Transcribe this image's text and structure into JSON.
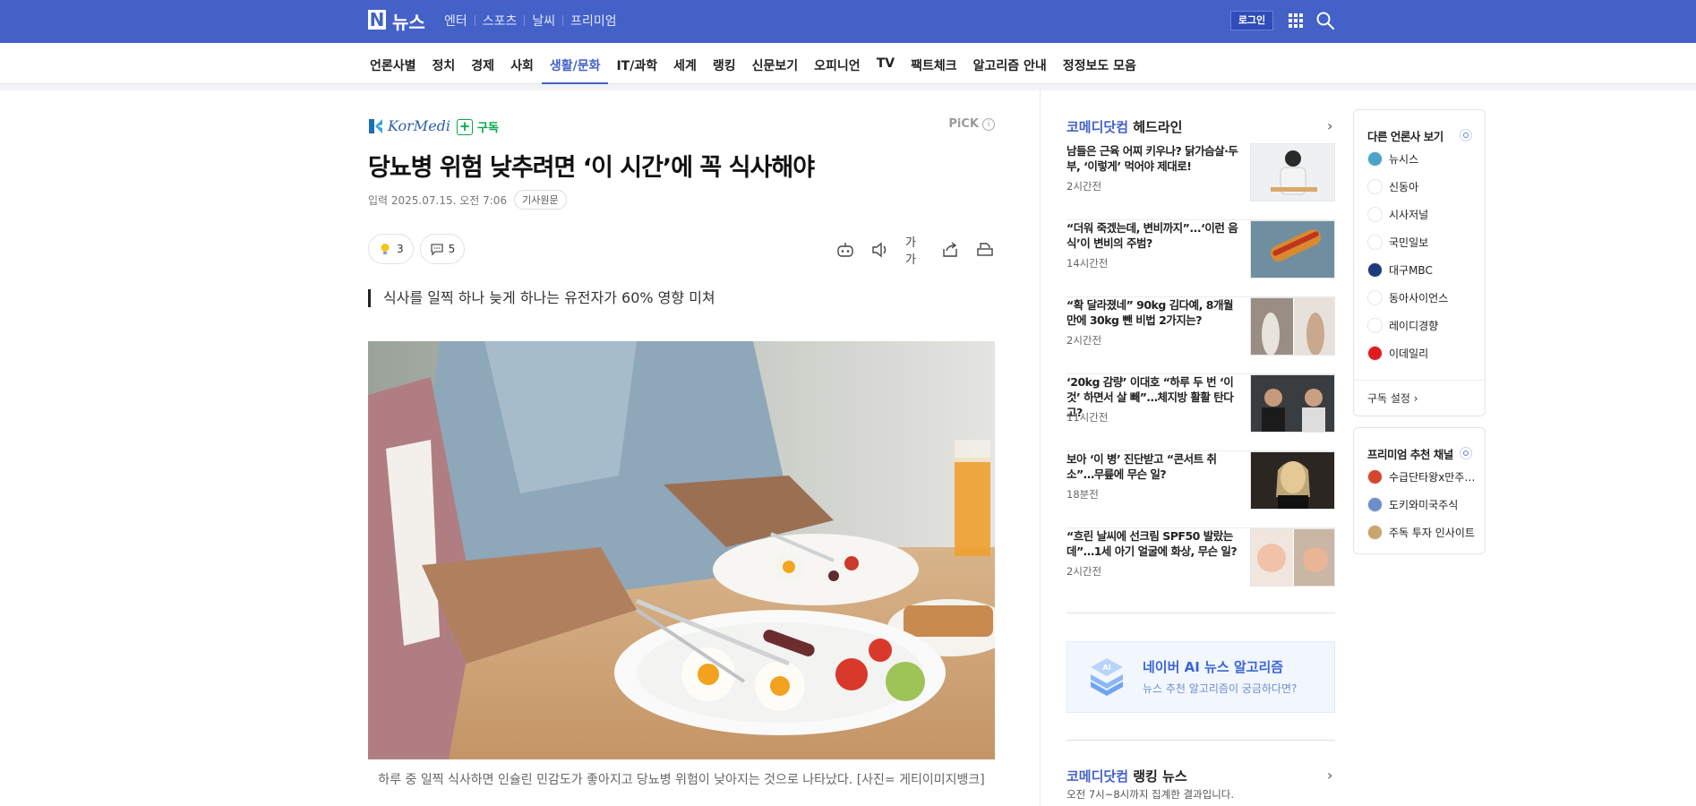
{
  "topbar": {
    "logo_letter": "N",
    "brand": "뉴스",
    "nav": [
      "엔터",
      "스포츠",
      "날씨",
      "프리미엄"
    ],
    "login_label": "로그인"
  },
  "category_nav": {
    "items": [
      "언론사별",
      "정치",
      "경제",
      "사회",
      "생활/문화",
      "IT/과학",
      "세계",
      "랭킹",
      "신문보기",
      "오피니언",
      "TV",
      "팩트체크",
      "알고리즘 안내",
      "정정보도 모음"
    ],
    "active": "생활/문화"
  },
  "article": {
    "press_name": "KorMedi",
    "subscribe_label": "구독",
    "pick_label": "PiCK",
    "pick_info": "i",
    "headline": "당뇨병 위험 낮추려면 ‘이 시간’에 꼭 식사해야",
    "meta": {
      "date": "입력 2025.07.15. 오전 7:06",
      "original_label": "기사원문"
    },
    "reactions": {
      "likes": "3",
      "comments": "5"
    },
    "text_size_label": "가가",
    "summary": "식사를 일찍 하나 늦게 하나는 유전자가 60% 영향 미쳐",
    "caption": "하루 중 일찍 식사하면 인슐린 민감도가 좋아지고 당뇨병 위험이 낮아지는 것으로 나타났다. [사진= 게티이미지뱅크]"
  },
  "headlines": {
    "press": "코메디닷컴",
    "title_suffix": " 헤드라인",
    "items": [
      {
        "title": "남들은 근육 어찌 키우나? 닭가슴살·두부, ‘이렇게’ 먹어야 제대로!",
        "ago": "2시간전"
      },
      {
        "title": "“더워 죽겠는데, 변비까지”...‘이런 음식’이 변비의 주범?",
        "ago": "14시간전"
      },
      {
        "title": "“확 달라졌네” 90kg 김다예, 8개월 만에 30kg 뺀 비법 2가지는?",
        "ago": "2시간전"
      },
      {
        "title": "‘20kg 감량’ 이대호 “하루 두 번 ‘이것’ 하면서 살 빼”…체지방 활활 탄다고?",
        "ago": "11시간전"
      },
      {
        "title": "보아 ‘이 병’ 진단받고 “콘서트 취소”…무릎에 무슨 일?",
        "ago": "18분전"
      },
      {
        "title": "“흐린 날씨에 선크림 SPF50 발랐는데”…1세 아기 얼굴에 화상, 무슨 일?",
        "ago": "2시간전"
      }
    ],
    "ai_box": {
      "title": "네이버 AI 뉴스 알고리즘",
      "subtitle": "뉴스 추천 알고리즘이 궁금하다면?",
      "icon_text": "AI"
    },
    "ranking": {
      "press": "코메디닷컴",
      "title_suffix": " 랭킹 뉴스",
      "subtitle": "오전 7시~8시까지 집계한 결과입니다."
    }
  },
  "other_press": {
    "title": "다른 언론사 보기",
    "items": [
      {
        "name": "뉴시스",
        "color": "#4aa3c9"
      },
      {
        "name": "신동아",
        "color": "#ffffff"
      },
      {
        "name": "시사저널",
        "color": "#ffffff"
      },
      {
        "name": "국민일보",
        "color": "#ffffff"
      },
      {
        "name": "대구MBC",
        "color": "#1f3a7a"
      },
      {
        "name": "동아사이언스",
        "color": "#ffffff"
      },
      {
        "name": "레이디경향",
        "color": "#ffffff"
      },
      {
        "name": "이데일리",
        "color": "#e11a1f"
      }
    ],
    "footer": "구독 설정"
  },
  "premium": {
    "title": "프리미엄 추천 채널",
    "items": [
      {
        "name": "수급단타왕x만주…",
        "color": "#d4472f"
      },
      {
        "name": "도키와미국주식",
        "color": "#6d8fc9"
      },
      {
        "name": "주독 투자 인사이트",
        "color": "#c9a66b"
      }
    ]
  },
  "colors": {
    "brand_blue": "#4461c8",
    "subscribe_green": "#03a94d"
  }
}
